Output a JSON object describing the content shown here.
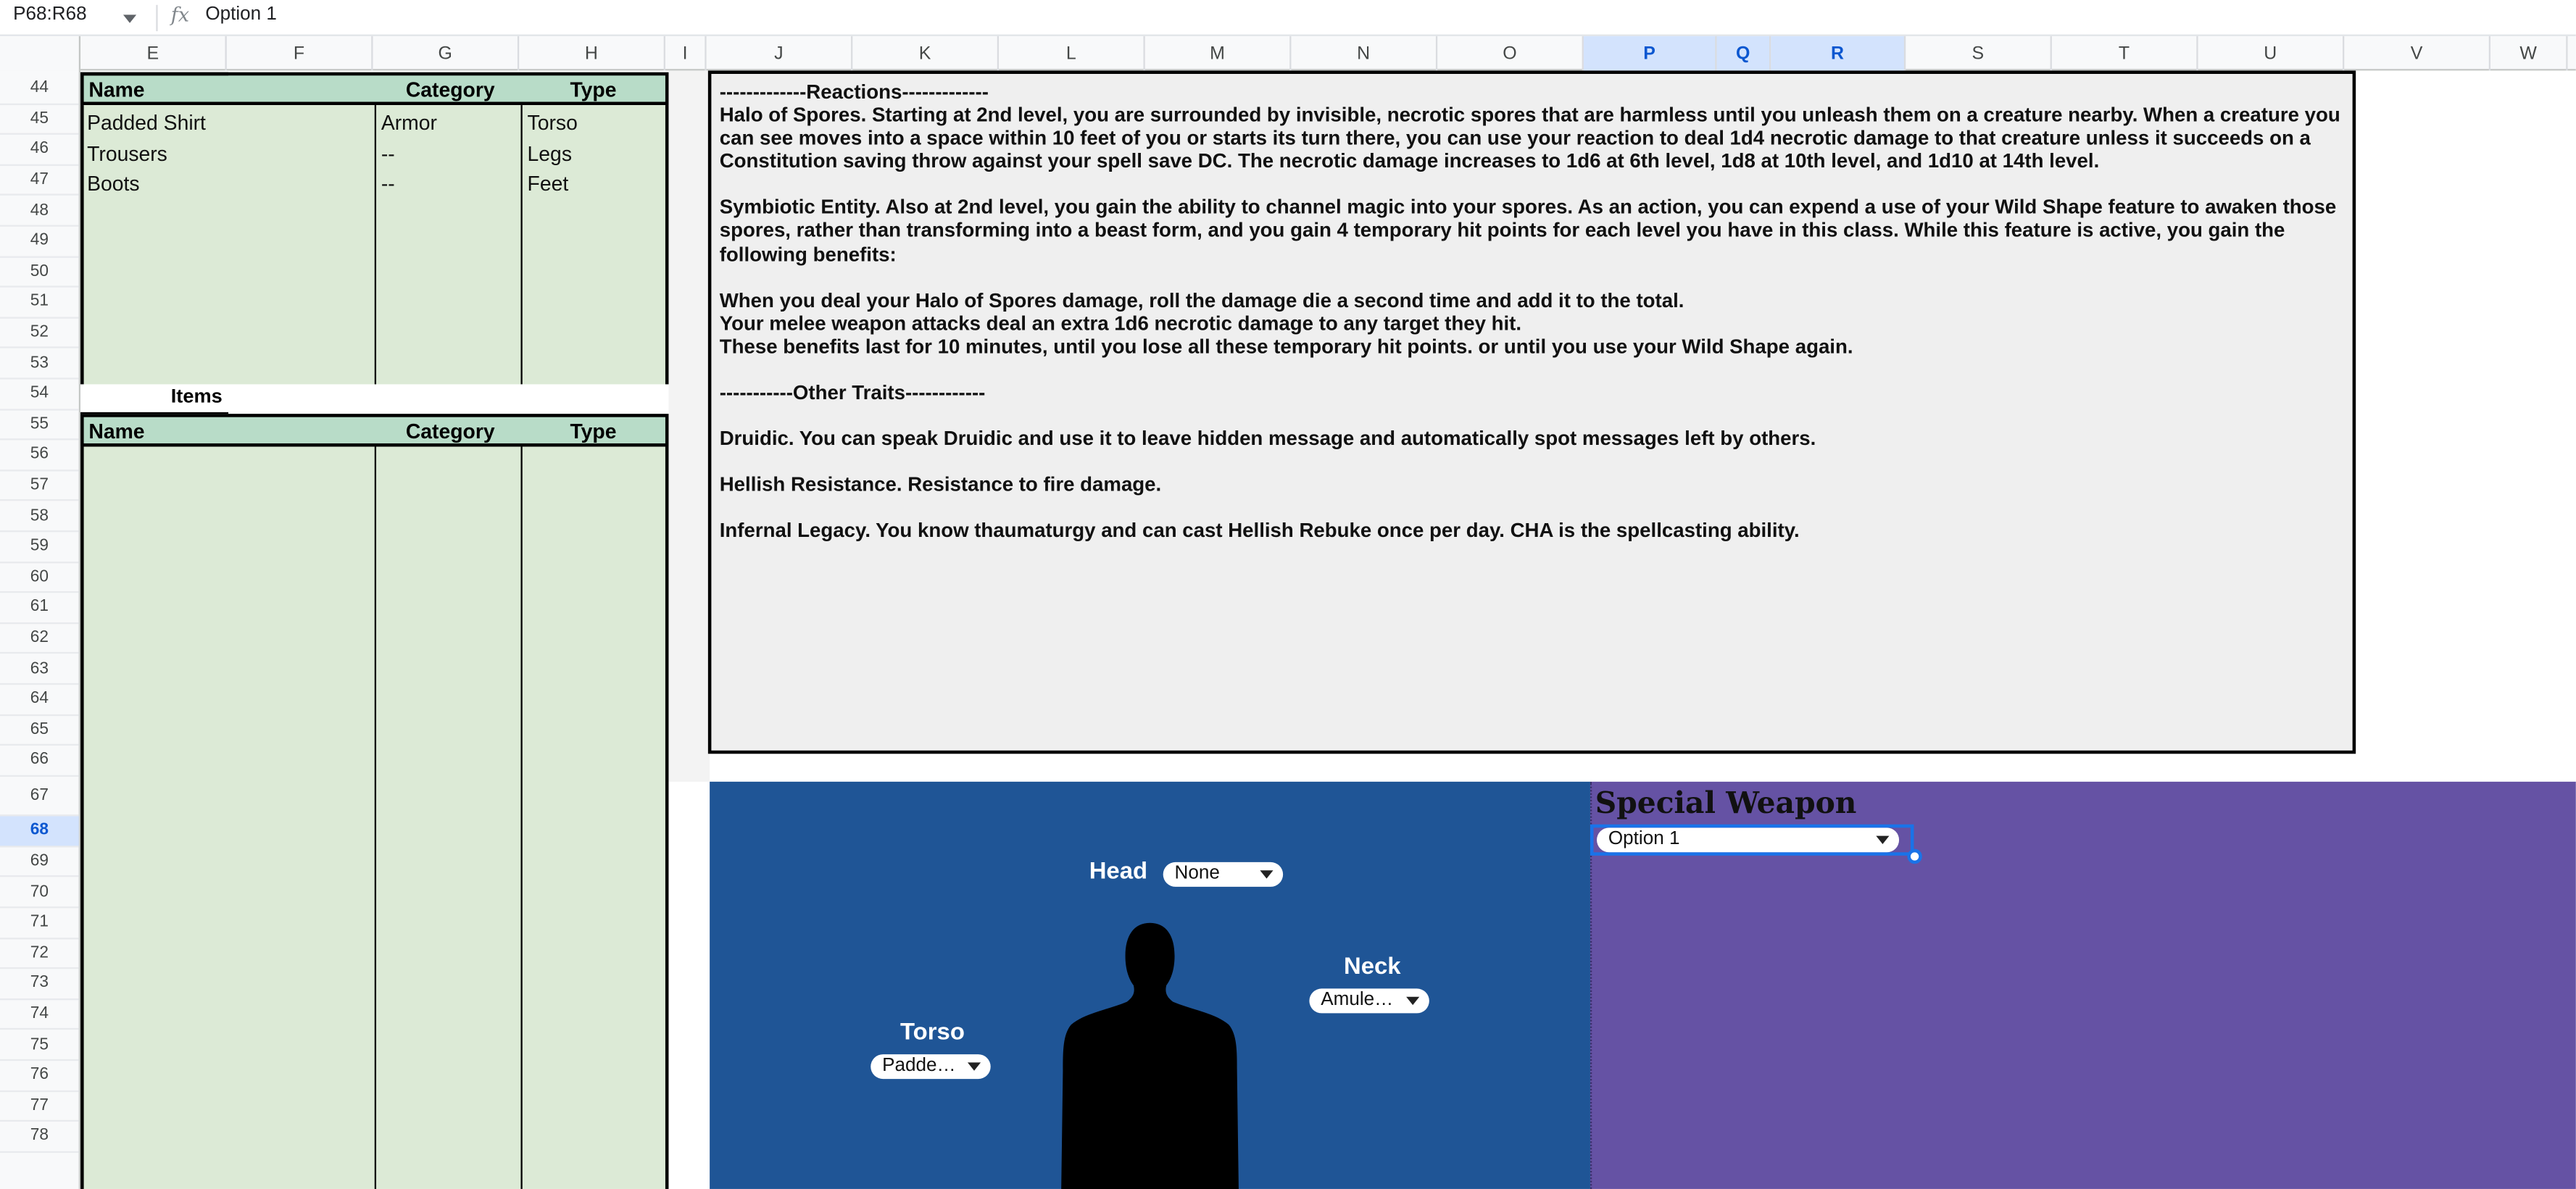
{
  "formula_bar": {
    "name_box": "P68:R68",
    "fx_icon": "fx",
    "formula": "Option 1"
  },
  "columns": [
    "E",
    "F",
    "G",
    "H",
    "I",
    "J",
    "K",
    "L",
    "M",
    "N",
    "O",
    "P",
    "Q",
    "R",
    "S",
    "T",
    "U",
    "V",
    "W"
  ],
  "selected_columns": [
    "P",
    "Q",
    "R"
  ],
  "rows": [
    "44",
    "45",
    "46",
    "47",
    "48",
    "49",
    "50",
    "51",
    "52",
    "53",
    "54",
    "55",
    "56",
    "57",
    "58",
    "59",
    "60",
    "61",
    "62",
    "63",
    "64",
    "65",
    "66",
    "67",
    "68",
    "69",
    "70",
    "71",
    "72",
    "73",
    "74",
    "75",
    "76",
    "77",
    "78"
  ],
  "selected_row": "68",
  "equipment_table": {
    "headers": {
      "name": "Name",
      "category": "Category",
      "type": "Type"
    },
    "rows": [
      {
        "name": "Padded Shirt",
        "category": "Armor",
        "type": "Torso"
      },
      {
        "name": "Trousers",
        "category": "--",
        "type": "Legs"
      },
      {
        "name": "Boots",
        "category": "--",
        "type": "Feet"
      }
    ]
  },
  "items_table": {
    "title": "Items",
    "headers": {
      "name": "Name",
      "category": "Category",
      "type": "Type"
    }
  },
  "traits_text": {
    "reactions_header": "-------------Reactions-------------",
    "halo": "Halo of Spores. Starting at 2nd level, you are surrounded by invisible, necrotic spores that are harmless until you unleash them on a creature nearby. When a creature you can see moves into a space within 10 feet of you or starts its turn there, you can use your reaction to deal 1d4 necrotic damage to that creature unless it succeeds on a Constitution saving throw against your spell save DC. The necrotic damage increases to 1d6 at 6th level, 1d8 at 10th level, and 1d10 at 14th level.",
    "symbiotic": "Symbiotic Entity. Also at 2nd level, you gain the ability to channel magic into your spores. As an action, you can expend a use of your Wild Shape feature to awaken those spores, rather than transforming into a beast form, and you gain 4 temporary hit points for each level you have in this class. While this feature is active, you gain the following benefits:",
    "benefit1": "When you deal your Halo of Spores damage, roll the damage die a second time and add it to the total.",
    "benefit2": "Your melee weapon attacks deal an extra 1d6 necrotic damage to any target they hit.",
    "benefit3": "These benefits last for 10 minutes, until you lose all these temporary hit points. or until you use your Wild Shape again.",
    "other_header": "-----------Other Traits------------",
    "druidic": "Druidic. You can speak Druidic and use it to leave hidden message and automatically spot messages left by others.",
    "hellish": "Hellish Resistance. Resistance to fire damage.",
    "infernal": "Infernal Legacy. You know thaumaturgy and can cast Hellish Rebuke once per day. CHA is the spellcasting ability."
  },
  "body_slots": {
    "head": {
      "label": "Head",
      "value": "None"
    },
    "neck": {
      "label": "Neck",
      "value": "Amule…"
    },
    "torso": {
      "label": "Torso",
      "value": "Padde…"
    }
  },
  "special_weapon": {
    "title": "Special Weapon",
    "value": "Option 1"
  },
  "colors": {
    "table_header": "#b8dcc8",
    "table_body": "#dcead6",
    "body_panel": "#1f5596",
    "special_panel": "#6552a4",
    "selection": "#1a73e8"
  }
}
